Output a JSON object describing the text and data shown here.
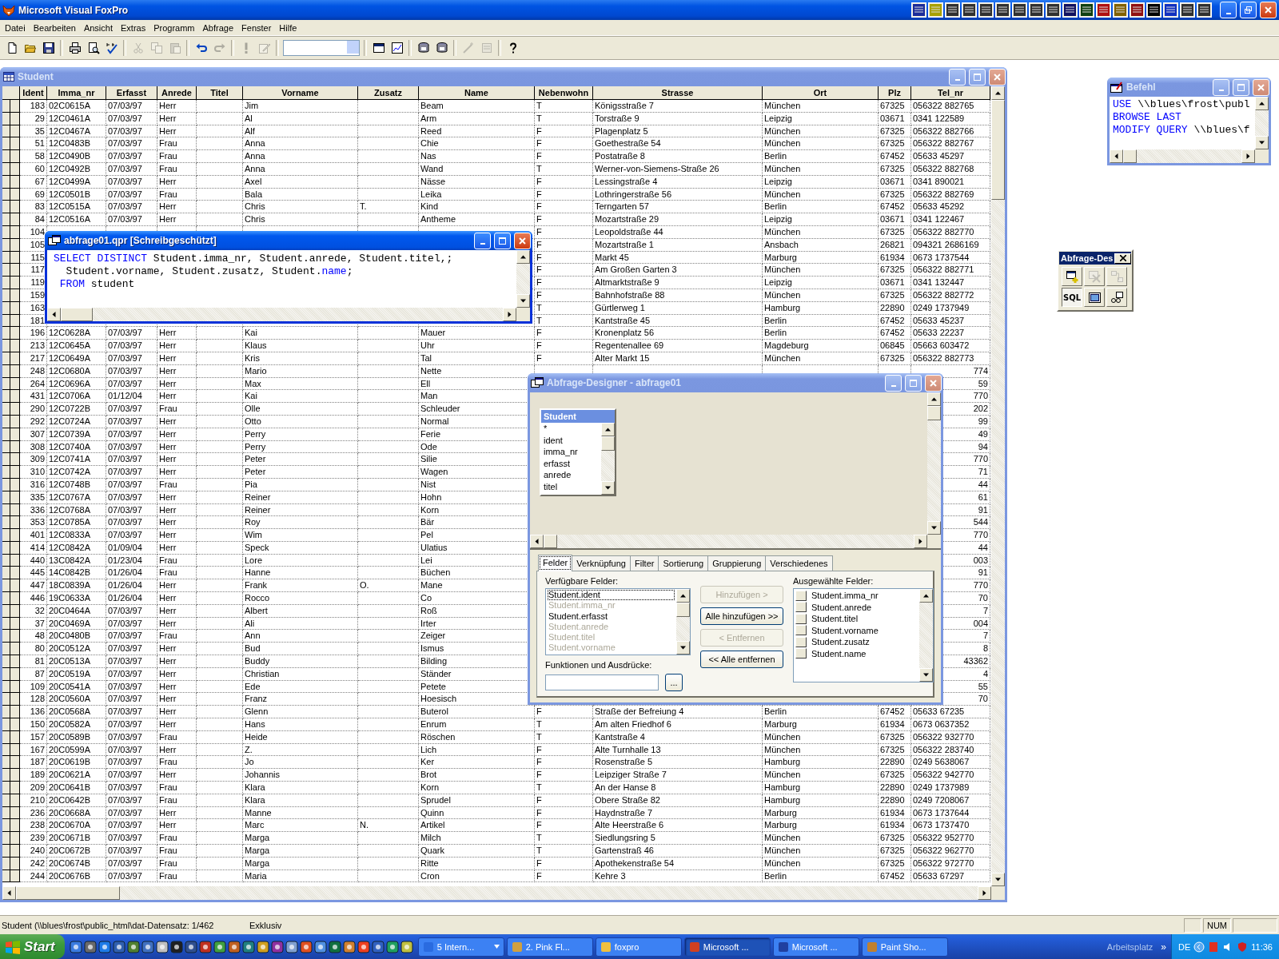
{
  "app": {
    "title": "Microsoft Visual FoxPro"
  },
  "menu": [
    "Datei",
    "Bearbeiten",
    "Ansicht",
    "Extras",
    "Programm",
    "Abfrage",
    "Fenster",
    "Hilfe"
  ],
  "toolbar": {
    "tools": [
      {
        "kind": "new",
        "disabled": false
      },
      {
        "kind": "open",
        "disabled": false
      },
      {
        "kind": "save",
        "disabled": false
      },
      {
        "kind": "separator"
      },
      {
        "kind": "print",
        "disabled": false
      },
      {
        "kind": "preview",
        "disabled": false
      },
      {
        "kind": "spell",
        "disabled": false
      },
      {
        "kind": "separator"
      },
      {
        "kind": "cut",
        "disabled": true
      },
      {
        "kind": "copy",
        "disabled": true
      },
      {
        "kind": "paste",
        "disabled": true
      },
      {
        "kind": "separator"
      },
      {
        "kind": "undo",
        "disabled": false
      },
      {
        "kind": "redo",
        "disabled": true
      },
      {
        "kind": "separator"
      },
      {
        "kind": "run",
        "disabled": true
      },
      {
        "kind": "modify",
        "disabled": true
      },
      {
        "kind": "separator"
      },
      {
        "kind": "combo"
      },
      {
        "kind": "separator"
      },
      {
        "kind": "window",
        "disabled": false
      },
      {
        "kind": "form",
        "disabled": false
      },
      {
        "kind": "separator"
      },
      {
        "kind": "db",
        "disabled": false
      },
      {
        "kind": "db",
        "disabled": false
      },
      {
        "kind": "separator"
      },
      {
        "kind": "wizard",
        "disabled": true
      },
      {
        "kind": "edit",
        "disabled": true
      },
      {
        "kind": "separator"
      },
      {
        "kind": "help",
        "disabled": false
      }
    ]
  },
  "browse_window": {
    "title": "Student",
    "active": false,
    "columns": [
      "Ident",
      "Imma_nr",
      "Erfasst",
      "Anrede",
      "Titel",
      "Vorname",
      "Zusatz",
      "Name",
      "Nebenwohn",
      "Strasse",
      "Ort",
      "Plz",
      "Tel_nr"
    ],
    "rows": [
      {
        "kind": "full",
        "cells": [
          "183",
          "02C0615A",
          "07/03/97",
          "Herr",
          null,
          "Jim",
          null,
          "Beam",
          "T",
          "Königsstraße 7",
          "München",
          "67325",
          "056322 882765"
        ]
      },
      {
        "kind": "full",
        "cells": [
          "29",
          "12C0461A",
          "07/03/97",
          "Herr",
          null,
          "Al",
          null,
          "Arm",
          "T",
          "Torstraße 9",
          "Leipzig",
          "03671",
          "0341 122589"
        ]
      },
      {
        "kind": "full",
        "cells": [
          "35",
          "12C0467A",
          "07/03/97",
          "Herr",
          null,
          "Alf",
          null,
          "Reed",
          "F",
          "Plagenplatz 5",
          "München",
          "67325",
          "056322 882766"
        ]
      },
      {
        "kind": "full",
        "cells": [
          "51",
          "12C0483B",
          "07/03/97",
          "Frau",
          null,
          "Anna",
          null,
          "Chie",
          "F",
          "Goethestraße 54",
          "München",
          "67325",
          "056322 882767"
        ]
      },
      {
        "kind": "full",
        "cells": [
          "58",
          "12C0490B",
          "07/03/97",
          "Frau",
          null,
          "Anna",
          null,
          "Nas",
          "F",
          "Postatraße 8",
          "Berlin",
          "67452",
          "05633 45297"
        ]
      },
      {
        "kind": "full",
        "cells": [
          "60",
          "12C0492B",
          "07/03/97",
          "Frau",
          null,
          "Anna",
          null,
          "Wand",
          "T",
          "Werner-von-Siemens-Straße 26",
          "München",
          "67325",
          "056322 882768"
        ]
      },
      {
        "kind": "full",
        "cells": [
          "67",
          "12C0499A",
          "07/03/97",
          "Herr",
          null,
          "Axel",
          null,
          "Nässe",
          "F",
          "Lessingstraße 4",
          "Leipzig",
          "03671",
          "0341 890021"
        ]
      },
      {
        "kind": "full",
        "cells": [
          "69",
          "12C0501B",
          "07/03/97",
          "Frau",
          null,
          "Bala",
          null,
          "Leika",
          "F",
          "Lothringerstraße 56",
          "München",
          "67325",
          "056322 882769"
        ]
      },
      {
        "kind": "full",
        "cells": [
          "83",
          "12C0515A",
          "07/03/97",
          "Herr",
          null,
          "Chris",
          "T.",
          "Kind",
          "F",
          "Terngarten 57",
          "Berlin",
          "67452",
          "05633 45292"
        ]
      },
      {
        "kind": "full",
        "cells": [
          "84",
          "12C0516A",
          "07/03/97",
          "Herr",
          null,
          "Chris",
          null,
          "Antheme",
          "F",
          "Mozartstraße 29",
          "Leipzig",
          "03671",
          "0341 122467"
        ]
      },
      {
        "kind": "full",
        "cells": [
          "104",
          null,
          null,
          null,
          null,
          null,
          null,
          null,
          "F",
          "Leopoldstraße 44",
          "München",
          "67325",
          "056322 882770"
        ]
      },
      {
        "kind": "full",
        "cells": [
          "105",
          null,
          null,
          null,
          null,
          null,
          null,
          null,
          "F",
          "Mozartstraße 1",
          "Ansbach",
          "26821",
          "094321 2686169"
        ]
      },
      {
        "kind": "full",
        "cells": [
          "115",
          null,
          null,
          null,
          null,
          null,
          null,
          null,
          "F",
          "Markt 45",
          "Marburg",
          "61934",
          "0673 1737544"
        ]
      },
      {
        "kind": "full",
        "cells": [
          "117",
          null,
          null,
          null,
          null,
          null,
          null,
          null,
          "F",
          "Am Großen Garten 3",
          "München",
          "67325",
          "056322 882771"
        ]
      },
      {
        "kind": "full",
        "cells": [
          "119",
          null,
          null,
          null,
          null,
          null,
          null,
          null,
          "F",
          "Altmarktstraße 9",
          "Leipzig",
          "03671",
          "0341 132447"
        ]
      },
      {
        "kind": "full",
        "cells": [
          "159",
          null,
          null,
          null,
          null,
          null,
          null,
          null,
          "F",
          "Bahnhofstraße 88",
          "München",
          "67325",
          "056322 882772"
        ]
      },
      {
        "kind": "full",
        "cells": [
          "163",
          null,
          null,
          null,
          null,
          null,
          null,
          null,
          "T",
          "Gürtlerweg 1",
          "Hamburg",
          "22890",
          "0249 1737949"
        ]
      },
      {
        "kind": "full",
        "cells": [
          "181",
          null,
          null,
          null,
          null,
          null,
          null,
          null,
          "T",
          "Kantstraße 45",
          "Berlin",
          "67452",
          "05633 45237"
        ]
      },
      {
        "kind": "full",
        "cells": [
          "196",
          "12C0628A",
          "07/03/97",
          "Herr",
          null,
          "Kai",
          null,
          "Mauer",
          "F",
          "Kronenplatz 56",
          "Berlin",
          "67452",
          "05633 22237"
        ]
      },
      {
        "kind": "full",
        "cells": [
          "213",
          "12C0645A",
          "07/03/97",
          "Herr",
          null,
          "Klaus",
          null,
          "Uhr",
          "F",
          "Regentenallee 69",
          "Magdeburg",
          "06845",
          "05663 603472"
        ]
      },
      {
        "kind": "full",
        "cells": [
          "217",
          "12C0649A",
          "07/03/97",
          "Herr",
          null,
          "Kris",
          null,
          "Tal",
          "F",
          "Alter Markt 15",
          "München",
          "67325",
          "056322 882773"
        ]
      },
      {
        "kind": "tail",
        "cells": [
          "248",
          "12C0680A",
          "07/03/97",
          "Herr",
          null,
          "Mario",
          null,
          "Nette",
          null,
          null,
          null,
          null,
          "774"
        ]
      },
      {
        "kind": "tail",
        "cells": [
          "264",
          "12C0696A",
          "07/03/97",
          "Herr",
          null,
          "Max",
          null,
          "Ell",
          null,
          null,
          null,
          null,
          "59"
        ]
      },
      {
        "kind": "tail",
        "cells": [
          "431",
          "12C0706A",
          "01/12/04",
          "Herr",
          null,
          "Kai",
          null,
          "Man",
          null,
          null,
          null,
          null,
          "770"
        ]
      },
      {
        "kind": "tail",
        "cells": [
          "290",
          "12C0722B",
          "07/03/97",
          "Frau",
          null,
          "Olle",
          null,
          "Schleuder",
          null,
          null,
          null,
          null,
          "202"
        ]
      },
      {
        "kind": "tail",
        "cells": [
          "292",
          "12C0724A",
          "07/03/97",
          "Herr",
          null,
          "Otto",
          null,
          "Normal",
          null,
          null,
          null,
          null,
          "99"
        ]
      },
      {
        "kind": "tail",
        "cells": [
          "307",
          "12C0739A",
          "07/03/97",
          "Herr",
          null,
          "Perry",
          null,
          "Ferie",
          null,
          null,
          null,
          null,
          "49"
        ]
      },
      {
        "kind": "tail",
        "cells": [
          "308",
          "12C0740A",
          "07/03/97",
          "Herr",
          null,
          "Perry",
          null,
          "Ode",
          null,
          null,
          null,
          null,
          "94"
        ]
      },
      {
        "kind": "tail",
        "cells": [
          "309",
          "12C0741A",
          "07/03/97",
          "Herr",
          null,
          "Peter",
          null,
          "Silie",
          null,
          null,
          null,
          null,
          "770"
        ]
      },
      {
        "kind": "tail",
        "cells": [
          "310",
          "12C0742A",
          "07/03/97",
          "Herr",
          null,
          "Peter",
          null,
          "Wagen",
          null,
          null,
          null,
          null,
          "71"
        ]
      },
      {
        "kind": "tail",
        "cells": [
          "316",
          "12C0748B",
          "07/03/97",
          "Frau",
          null,
          "Pia",
          null,
          "Nist",
          null,
          null,
          null,
          null,
          "44"
        ]
      },
      {
        "kind": "tail",
        "cells": [
          "335",
          "12C0767A",
          "07/03/97",
          "Herr",
          null,
          "Reiner",
          null,
          "Hohn",
          null,
          null,
          null,
          null,
          "61"
        ]
      },
      {
        "kind": "tail",
        "cells": [
          "336",
          "12C0768A",
          "07/03/97",
          "Herr",
          null,
          "Reiner",
          null,
          "Korn",
          null,
          null,
          null,
          null,
          "91"
        ]
      },
      {
        "kind": "tail",
        "cells": [
          "353",
          "12C0785A",
          "07/03/97",
          "Herr",
          null,
          "Roy",
          null,
          "Bär",
          null,
          null,
          null,
          null,
          "544"
        ]
      },
      {
        "kind": "tail",
        "cells": [
          "401",
          "12C0833A",
          "07/03/97",
          "Herr",
          null,
          "Wim",
          null,
          "Pel",
          null,
          null,
          null,
          null,
          "770"
        ]
      },
      {
        "kind": "tail",
        "cells": [
          "414",
          "12C0842A",
          "01/09/04",
          "Herr",
          null,
          "Speck",
          null,
          "Ulatius",
          null,
          null,
          null,
          null,
          "44"
        ]
      },
      {
        "kind": "tail",
        "cells": [
          "440",
          "13C0842A",
          "01/23/04",
          "Frau",
          null,
          "Lore",
          null,
          "Lei",
          null,
          null,
          null,
          null,
          "003"
        ]
      },
      {
        "kind": "tail",
        "cells": [
          "445",
          "14C0842B",
          "01/26/04",
          "Frau",
          null,
          "Hanne",
          null,
          "Büchen",
          null,
          null,
          null,
          null,
          "91"
        ]
      },
      {
        "kind": "tail",
        "cells": [
          "447",
          "18C0839A",
          "01/26/04",
          "Herr",
          null,
          "Frank",
          "O.",
          "Mane",
          null,
          null,
          null,
          null,
          "770"
        ]
      },
      {
        "kind": "tail",
        "cells": [
          "446",
          "19C0633A",
          "01/26/04",
          "Herr",
          null,
          "Rocco",
          null,
          "Co",
          null,
          null,
          null,
          null,
          "70"
        ]
      },
      {
        "kind": "tail",
        "cells": [
          "32",
          "20C0464A",
          "07/03/97",
          "Herr",
          null,
          "Albert",
          null,
          "Roß",
          null,
          null,
          null,
          null,
          "7"
        ]
      },
      {
        "kind": "tail",
        "cells": [
          "37",
          "20C0469A",
          "07/03/97",
          "Herr",
          null,
          "Ali",
          null,
          "Irter",
          null,
          null,
          null,
          null,
          "004"
        ]
      },
      {
        "kind": "tail",
        "cells": [
          "48",
          "20C0480B",
          "07/03/97",
          "Frau",
          null,
          "Ann",
          null,
          "Zeiger",
          null,
          null,
          null,
          null,
          "7"
        ]
      },
      {
        "kind": "tail",
        "cells": [
          "80",
          "20C0512A",
          "07/03/97",
          "Herr",
          null,
          "Bud",
          null,
          "Ismus",
          null,
          null,
          null,
          null,
          "8"
        ]
      },
      {
        "kind": "tail",
        "cells": [
          "81",
          "20C0513A",
          "07/03/97",
          "Herr",
          null,
          "Buddy",
          null,
          "Bilding",
          null,
          null,
          null,
          null,
          "43362"
        ]
      },
      {
        "kind": "tail",
        "cells": [
          "87",
          "20C0519A",
          "07/03/97",
          "Herr",
          null,
          "Christian",
          null,
          "Ständer",
          null,
          null,
          null,
          null,
          "4"
        ]
      },
      {
        "kind": "tail",
        "cells": [
          "109",
          "20C0541A",
          "07/03/97",
          "Herr",
          null,
          "Ede",
          null,
          "Petete",
          null,
          null,
          null,
          null,
          "55"
        ]
      },
      {
        "kind": "tail",
        "cells": [
          "128",
          "20C0560A",
          "07/03/97",
          "Herr",
          null,
          "Franz",
          null,
          "Hoesisch",
          null,
          null,
          null,
          null,
          "70"
        ]
      },
      {
        "kind": "full",
        "cells": [
          "136",
          "20C0568A",
          "07/03/97",
          "Herr",
          null,
          "Glenn",
          null,
          "Buterol",
          "F",
          "Straße der Befreiung 4",
          "Berlin",
          "67452",
          "05633 67235"
        ]
      },
      {
        "kind": "full",
        "cells": [
          "150",
          "20C0582A",
          "07/03/97",
          "Herr",
          null,
          "Hans",
          null,
          "Enrum",
          "T",
          "Am alten Friedhof 6",
          "Marburg",
          "61934",
          "0673 0637352"
        ]
      },
      {
        "kind": "full",
        "cells": [
          "157",
          "20C0589B",
          "07/03/97",
          "Frau",
          null,
          "Heide",
          null,
          "Röschen",
          "T",
          "Kantstraße 4",
          "München",
          "67325",
          "056322 932770"
        ]
      },
      {
        "kind": "full",
        "cells": [
          "167",
          "20C0599A",
          "07/03/97",
          "Herr",
          null,
          "Z.",
          null,
          "Lich",
          "F",
          "Alte Turnhalle 13",
          "München",
          "67325",
          "056322 283740"
        ]
      },
      {
        "kind": "full",
        "cells": [
          "187",
          "20C0619B",
          "07/03/97",
          "Frau",
          null,
          "Jo",
          null,
          "Ker",
          "F",
          "Rosenstraße 5",
          "Hamburg",
          "22890",
          "0249 5638067"
        ]
      },
      {
        "kind": "full",
        "cells": [
          "189",
          "20C0621A",
          "07/03/97",
          "Herr",
          null,
          "Johannis",
          null,
          "Brot",
          "F",
          "Leipziger Straße 7",
          "München",
          "67325",
          "056322 942770"
        ]
      },
      {
        "kind": "full",
        "cells": [
          "209",
          "20C0641B",
          "07/03/97",
          "Frau",
          null,
          "Klara",
          null,
          "Korn",
          "T",
          "An der Hanse 8",
          "Hamburg",
          "22890",
          "0249 1737989"
        ]
      },
      {
        "kind": "full",
        "cells": [
          "210",
          "20C0642B",
          "07/03/97",
          "Frau",
          null,
          "Klara",
          null,
          "Sprudel",
          "F",
          "Obere Straße 82",
          "Hamburg",
          "22890",
          "0249 7208067"
        ]
      },
      {
        "kind": "full",
        "cells": [
          "236",
          "20C0668A",
          "07/03/97",
          "Herr",
          null,
          "Manne",
          null,
          "Quinn",
          "F",
          "Haydnstraße 7",
          "Marburg",
          "61934",
          "0673 1737644"
        ]
      },
      {
        "kind": "full",
        "cells": [
          "238",
          "20C0670A",
          "07/03/97",
          "Herr",
          null,
          "Marc",
          "N.",
          "Artikel",
          "F",
          "Alte Heerstraße 6",
          "Marburg",
          "61934",
          "0673 1737470"
        ]
      },
      {
        "kind": "full",
        "cells": [
          "239",
          "20C0671B",
          "07/03/97",
          "Frau",
          null,
          "Marga",
          null,
          "Milch",
          "T",
          "Siedlungsring 5",
          "München",
          "67325",
          "056322 952770"
        ]
      },
      {
        "kind": "full",
        "cells": [
          "240",
          "20C0672B",
          "07/03/97",
          "Frau",
          null,
          "Marga",
          null,
          "Quark",
          "T",
          "Gartenstraß 46",
          "München",
          "67325",
          "056322 962770"
        ]
      },
      {
        "kind": "full",
        "cells": [
          "242",
          "20C0674B",
          "07/03/97",
          "Frau",
          null,
          "Marga",
          null,
          "Ritte",
          "F",
          "Apothekenstraße 54",
          "München",
          "67325",
          "056322 972770"
        ]
      },
      {
        "kind": "full",
        "cells": [
          "244",
          "20C0676B",
          "07/03/97",
          "Frau",
          null,
          "Maria",
          null,
          "Cron",
          "F",
          "Kehre 3",
          "Berlin",
          "67452",
          "05633 67297"
        ]
      }
    ]
  },
  "query_window": {
    "title": "abfrage01.qpr [Schreibgeschützt]",
    "active": true,
    "lines": [
      [
        {
          "text": "SELECT DISTINCT",
          "kind": "keyword"
        },
        {
          "text": " Student.imma_nr, Student.anrede, Student.titel,;",
          "kind": "plain"
        }
      ],
      [
        {
          "text": "  Student.vorname, Student.zusatz, Student.",
          "kind": "plain"
        },
        {
          "text": "name",
          "kind": "keyword"
        },
        {
          "text": ";",
          "kind": "plain"
        }
      ],
      [
        {
          "text": " FROM",
          "kind": "keyword"
        },
        {
          "text": " student",
          "kind": "plain"
        }
      ]
    ]
  },
  "command_window": {
    "title": "Befehl",
    "active": false,
    "lines": [
      [
        {
          "text": "USE",
          "kind": "keyword"
        },
        {
          "text": " \\\\blues\\frost\\publ",
          "kind": "plain"
        }
      ],
      [
        {
          "text": "BROWSE LAST",
          "kind": "keyword"
        }
      ],
      [
        {
          "text": "MODIFY QUERY",
          "kind": "keyword"
        },
        {
          "text": " \\\\blues\\f",
          "kind": "plain"
        }
      ]
    ]
  },
  "designer_toolbar": {
    "title": "Abfrage-Des",
    "tools": [
      {
        "kind": "add_table",
        "disabled": false,
        "pressed": false
      },
      {
        "kind": "remove_table",
        "disabled": true,
        "pressed": false
      },
      {
        "kind": "join",
        "disabled": true,
        "pressed": false
      },
      {
        "kind": "sql",
        "label": "SQL",
        "disabled": false,
        "pressed": true
      },
      {
        "kind": "view",
        "disabled": false,
        "pressed": false
      },
      {
        "kind": "destination",
        "disabled": false,
        "pressed": false
      }
    ]
  },
  "designer": {
    "title": "Abfrage-Designer - abfrage01",
    "active": false,
    "table": {
      "name": "Student",
      "fields": [
        "*",
        "ident",
        "imma_nr",
        "erfasst",
        "anrede",
        "titel"
      ]
    },
    "tabs": [
      {
        "label": "Felder",
        "selected": true
      },
      {
        "label": "Verknüpfung",
        "selected": false
      },
      {
        "label": "Filter",
        "selected": false
      },
      {
        "label": "Sortierung",
        "selected": false
      },
      {
        "label": "Gruppierung",
        "selected": false
      },
      {
        "label": "Verschiedenes",
        "selected": false
      }
    ],
    "available_label": "Verfügbare Felder:",
    "available": [
      {
        "label": "Student.ident",
        "selected": true,
        "disabled": false
      },
      {
        "label": "Student.imma_nr",
        "selected": false,
        "disabled": true
      },
      {
        "label": "Student.erfasst",
        "selected": false,
        "disabled": false
      },
      {
        "label": "Student.anrede",
        "selected": false,
        "disabled": true
      },
      {
        "label": "Student.titel",
        "selected": false,
        "disabled": true
      },
      {
        "label": "Student.vorname",
        "selected": false,
        "disabled": true
      }
    ],
    "buttons": [
      {
        "label": "Hinzufügen >",
        "disabled": true
      },
      {
        "label": "Alle hinzufügen >>",
        "disabled": false
      },
      {
        "label": "< Entfernen",
        "disabled": true
      },
      {
        "label": "<< Alle entfernen",
        "disabled": false
      }
    ],
    "expr_label": "Funktionen und Ausdrücke:",
    "expr_button": "...",
    "selected_label": "Ausgewählte Felder:",
    "selected_fields": [
      "Student.imma_nr",
      "Student.anrede",
      "Student.titel",
      "Student.vorname",
      "Student.zusatz",
      "Student.name"
    ]
  },
  "status_bar": {
    "record": "Student (\\\\blues\\frost\\public_html\\dat-Datensatz: 1/462",
    "mode": "Exklusiv",
    "keys": [
      "NUM"
    ]
  },
  "taskbar": {
    "start": "Start",
    "tasks": [
      {
        "label": "5 Intern...",
        "kind": "group",
        "selected": false
      },
      {
        "label": "2. Pink Fl...",
        "kind": "single",
        "selected": false
      },
      {
        "label": "foxpro",
        "kind": "single",
        "selected": false
      },
      {
        "label": "Microsoft ...",
        "kind": "single",
        "selected": true
      },
      {
        "label": "Microsoft ...",
        "kind": "single",
        "selected": false
      },
      {
        "label": "Paint Sho...",
        "kind": "single",
        "selected": false
      }
    ],
    "toolbar_label": "Arbeitsplatz",
    "more": "»",
    "language": "DE",
    "clock": "11:36"
  }
}
